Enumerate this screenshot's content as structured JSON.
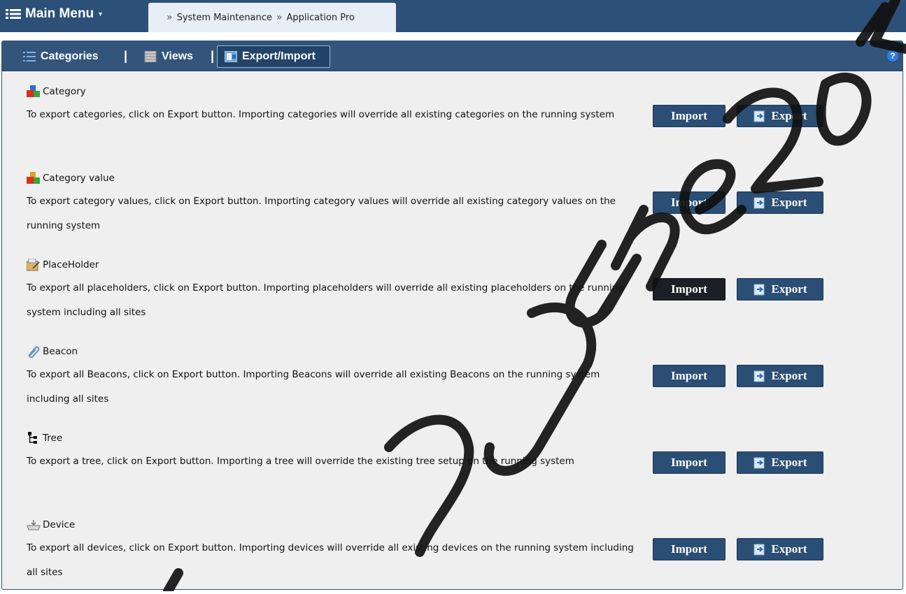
{
  "topbar": {
    "main_menu_label": "Main Menu",
    "breadcrumbs": [
      "System Maintenance",
      "Application Pro"
    ]
  },
  "tabs": [
    {
      "label": "Categories",
      "icon": "list-icon",
      "active": false
    },
    {
      "label": "Views",
      "icon": "views-icon",
      "active": false
    },
    {
      "label": "Export/Import",
      "icon": "export-import-icon",
      "active": true
    }
  ],
  "help_glyph": "?",
  "sections": [
    {
      "title": "Category",
      "icon": "category-icon",
      "description": "To export categories, click on Export button. Importing categories will override all existing categories on the running system",
      "import_label": "Import",
      "export_label": "Export"
    },
    {
      "title": "Category value",
      "icon": "category-value-icon",
      "description": "To export category values, click on Export button. Importing category values will override all existing category values on the running system",
      "import_label": "Import",
      "export_label": "Export"
    },
    {
      "title": "PlaceHolder",
      "icon": "placeholder-icon",
      "description": "To export all placeholders, click on Export button. Importing placeholders will override all existing placeholders on the running system including all sites",
      "import_label": "Import",
      "export_label": "Export"
    },
    {
      "title": "Beacon",
      "icon": "beacon-icon",
      "description": "To export all Beacons, click on Export button. Importing Beacons will override all existing Beacons on the running system including all sites",
      "import_label": "Import",
      "export_label": "Export"
    },
    {
      "title": "Tree",
      "icon": "tree-icon",
      "description": "To export a tree, click on Export button. Importing a tree will override the existing tree setup on the running system",
      "import_label": "Import",
      "export_label": "Export"
    },
    {
      "title": "Device",
      "icon": "device-icon",
      "description": "To export all devices, click on Export button. Importing devices will override all existing devices on the running system including all sites",
      "import_label": "Import",
      "export_label": "Export"
    }
  ],
  "colors": {
    "header_bg": "#2c5078",
    "tabbar_bg": "#33557c",
    "button_bg": "#2a4e74",
    "button_pressed_bg": "#1c1f25",
    "content_bg": "#efefef"
  }
}
